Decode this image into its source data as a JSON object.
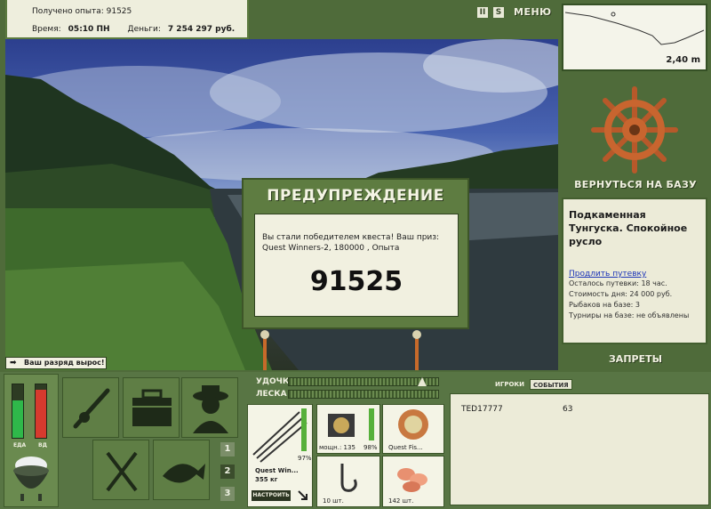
{
  "stats": {
    "exp_label": "Получено опыта:",
    "exp_value": "91525",
    "time_label": "Время:",
    "time_value": "05:10 ПН",
    "money_label": "Деньги:",
    "money_value": "7 254 297 руб."
  },
  "topbar": {
    "pause_glyph": "II",
    "sound_glyph": "S",
    "menu_label": "МЕНЮ"
  },
  "minimap": {
    "depth": "2,40 m"
  },
  "right": {
    "return_label": "ВЕРНУТЬСЯ НА БАЗУ",
    "location_name": "Подкаменная Тунгуска. Спокойное русло",
    "extend_label": "Продлить путевку",
    "info": [
      "Осталось путевки: 18 час.",
      "Стоимость дня: 24 000 руб.",
      "Рыбаков на базе: 3",
      "Турниры на базе: не объявлены"
    ],
    "bans_label": "ЗАПРЕТЫ"
  },
  "dialog": {
    "title": "ПРЕДУПРЕЖДЕНИЕ",
    "message": "Вы стали победителем квеста! Ваш приз: Quest Winners-2, 180000 , Опыта",
    "big_value": "91525"
  },
  "notify": {
    "text": "Ваш разряд вырос!"
  },
  "needs": {
    "food_label": "ЕДА",
    "food_level": 0.7,
    "drink_label": "ВД",
    "drink_level": 0.9
  },
  "levels": [
    "1",
    "2",
    "3"
  ],
  "tackle": {
    "rod_label": "УДОЧКА",
    "line_label": "ЛЕСКА",
    "rod_name": "Quest Win...",
    "rod_weight": "355 кг",
    "rod_percent": "97%",
    "setup_label": "НАСТРОИТЬ",
    "reel_caption": "мощн.: 135",
    "reel_percent": "98%",
    "line_caption": "Quest Fis...",
    "hook_caption": "10 шт.",
    "bait_caption": "142 шт."
  },
  "players": {
    "tab_players": "ИГРОКИ",
    "tab_events": "СОБЫТИЯ",
    "rows": [
      {
        "name": "TED17777",
        "value": "63"
      }
    ]
  },
  "colors": {
    "panel_green": "#5e7c41",
    "cream": "#eeeedd",
    "food_green": "#2fb84a",
    "drink_red": "#d63a2e",
    "link_blue": "#1b34b8"
  }
}
